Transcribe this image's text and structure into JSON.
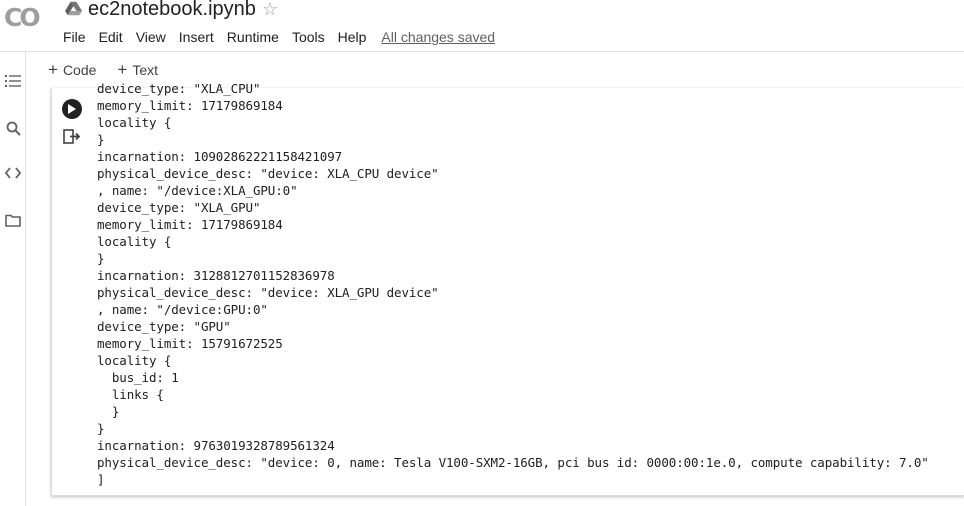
{
  "header": {
    "logo_text": "CO",
    "title": "ec2notebook.ipynb",
    "star": "☆"
  },
  "menu": [
    "File",
    "Edit",
    "View",
    "Insert",
    "Runtime",
    "Tools",
    "Help"
  ],
  "save_status": "All changes saved",
  "toolbar": {
    "code_plus": "+",
    "code_label": "Code",
    "text_plus": "+",
    "text_label": "Text"
  },
  "rail_icons": [
    "table-of-contents-icon",
    "search-icon",
    "code-snippets-icon",
    "files-icon"
  ],
  "output_lines": [
    "device_type: \"XLA_CPU\"",
    "memory_limit: 17179869184",
    "locality {",
    "}",
    "incarnation: 10902862221158421097",
    "physical_device_desc: \"device: XLA_CPU device\"",
    ", name: \"/device:XLA_GPU:0\"",
    "device_type: \"XLA_GPU\"",
    "memory_limit: 17179869184",
    "locality {",
    "}",
    "incarnation: 3128812701152836978",
    "physical_device_desc: \"device: XLA_GPU device\"",
    ", name: \"/device:GPU:0\"",
    "device_type: \"GPU\"",
    "memory_limit: 15791672525",
    "locality {",
    "  bus_id: 1",
    "  links {",
    "  }",
    "}",
    "incarnation: 9763019328789561324",
    "physical_device_desc: \"device: 0, name: Tesla V100-SXM2-16GB, pci bus id: 0000:00:1e.0, compute capability: 7.0\"",
    "]"
  ]
}
